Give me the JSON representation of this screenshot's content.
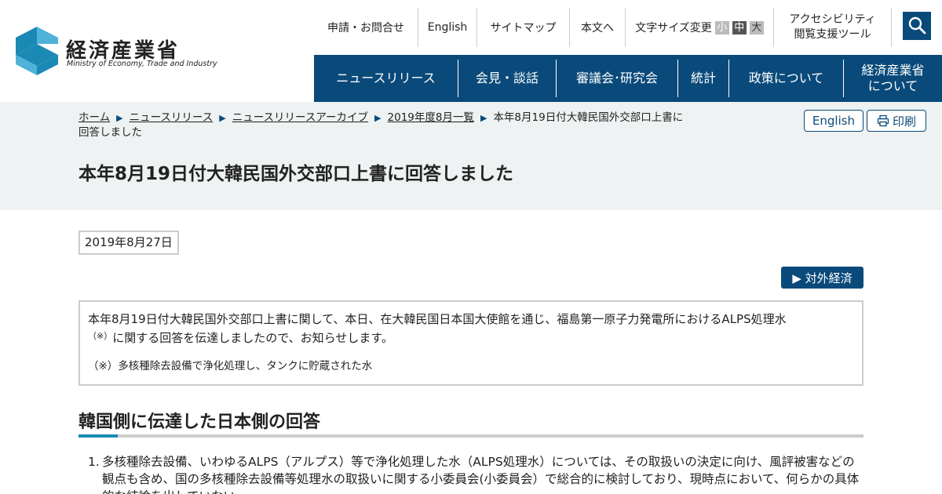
{
  "header": {
    "logo_name": "経済産業省",
    "logo_en": "Ministry of Economy, Trade and Industry",
    "util": {
      "inquiry": "申請・お問合せ",
      "english": "English",
      "sitemap": "サイトマップ",
      "to_body": "本文へ",
      "font_size_label": "文字サイズ変更",
      "font_small": "小",
      "font_mid": "中",
      "font_large": "大",
      "a11y_line1": "アクセシビリティ",
      "a11y_line2": "閲覧支援ツール"
    },
    "nav": [
      {
        "label": "ニュースリリース"
      },
      {
        "label": "会見・談話"
      },
      {
        "label": "審議会･研究会"
      },
      {
        "label": "統計"
      },
      {
        "label": "政策について"
      },
      {
        "label_line1": "経済産業省",
        "label_line2": "について"
      }
    ]
  },
  "breadcrumb": {
    "items": [
      "ホーム",
      "ニュースリリース",
      "ニュースリリースアーカイブ",
      "2019年度8月一覧"
    ],
    "current_line1": "本年8月19日付大韓民国外交部口上書に",
    "current_line2": "回答しました"
  },
  "actions": {
    "english": "English",
    "print": "印刷"
  },
  "page": {
    "title": "本年8月19日付大韓民国外交部口上書に回答しました",
    "date": "2019年8月27日",
    "category": "▶ 対外経済",
    "lead_line1": "本年8月19日付大韓民国外交部口上書に関して、本日、在大韓民国日本国大使館を通じ、福島第一原子力発電所におけるALPS処理水",
    "lead_mark": "（※）",
    "lead_line2": "に関する回答を伝達しましたので、お知らせします。",
    "note": "（※）多核種除去設備で浄化処理し、タンクに貯蔵された水",
    "section_heading": "韓国側に伝達した日本側の回答",
    "list_number": "1.",
    "list_item_1": "多核種除去設備、いわゆるALPS（アルプス）等で浄化処理した水（ALPS処理水）については、その取扱いの決定に向け、風評被害などの観点も含め、国の多核種除去設備等処理水の取扱いに関する小委員会(小委員会）で総合的に検討しており、現時点において、何らかの具体的な結論を出していない。"
  },
  "colors": {
    "brand_navy": "#0a4a7a",
    "accent_blue": "#1a8ab5",
    "band_bg": "#eef2f2",
    "logo_blue": "#1a8ab5"
  },
  "icons": {
    "search": "search-icon",
    "print": "printer-icon",
    "logo": "meti-logo-mark"
  }
}
